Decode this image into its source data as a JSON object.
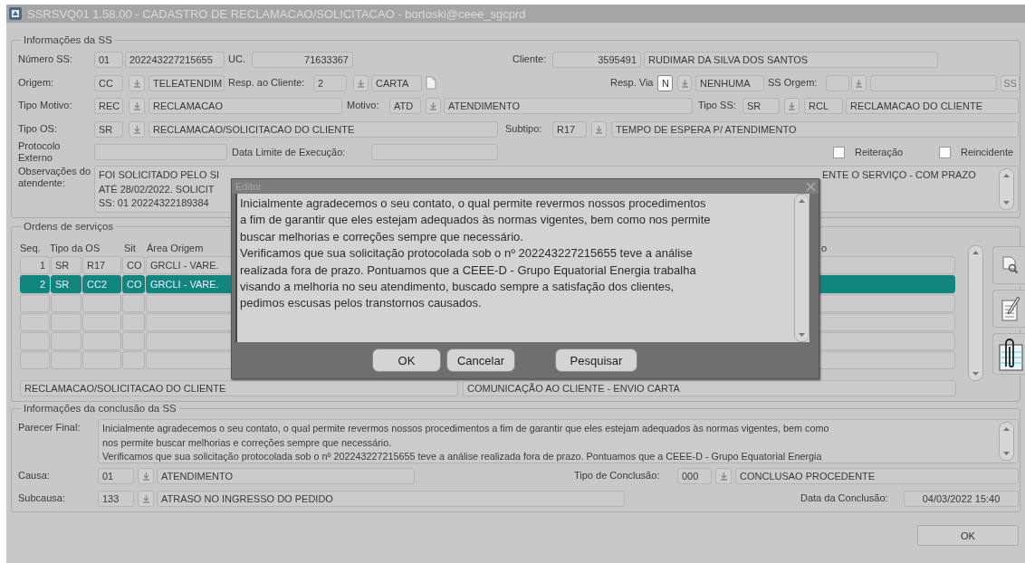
{
  "window": {
    "title": "SSRSVQ01 1.58.00 - CADASTRO DE RECLAMACAO/SOLICITACAO  - bortoski@ceee_sgcprd"
  },
  "info": {
    "title": "Informações da SS",
    "rows": [
      {
        "items": [
          {
            "kind": "label",
            "text": "Número SS:"
          },
          {
            "kind": "field",
            "value": "01"
          },
          {
            "kind": "field",
            "value": "202243227215655"
          },
          {
            "kind": "label",
            "text": "UC."
          },
          {
            "kind": "number",
            "value": "71633367"
          },
          {
            "kind": "label",
            "text": "Cliente:"
          },
          {
            "kind": "number",
            "value": "3595491"
          },
          {
            "kind": "field",
            "value": "RUDIMAR DA SILVA DOS SANTOS"
          }
        ]
      },
      {
        "items": [
          {
            "kind": "label",
            "text": "Origem:"
          },
          {
            "kind": "field",
            "value": "CC"
          },
          {
            "kind": "lov"
          },
          {
            "kind": "field",
            "value": "TELEATENDIM"
          },
          {
            "kind": "label",
            "text": "Resp. ao Cliente:"
          },
          {
            "kind": "field",
            "value": "2"
          },
          {
            "kind": "lov"
          },
          {
            "kind": "field",
            "value": "CARTA"
          },
          {
            "kind": "doc"
          },
          {
            "kind": "label",
            "text": "Resp. Via"
          },
          {
            "kind": "active",
            "value": "N"
          },
          {
            "kind": "lov"
          },
          {
            "kind": "field",
            "value": "NENHUMA"
          },
          {
            "kind": "label",
            "text": "SS Orgem:"
          },
          {
            "kind": "field"
          },
          {
            "kind": "lov"
          },
          {
            "kind": "field"
          },
          {
            "kind": "button",
            "text": "SS"
          }
        ]
      },
      {
        "items": [
          {
            "kind": "label",
            "text": "Tipo Motivo:"
          },
          {
            "kind": "field",
            "value": "REC"
          },
          {
            "kind": "lov"
          },
          {
            "kind": "field",
            "value": "RECLAMACAO"
          },
          {
            "kind": "label",
            "text": "Motivo:"
          },
          {
            "kind": "field",
            "value": "ATD"
          },
          {
            "kind": "lov"
          },
          {
            "kind": "field",
            "value": "ATENDIMENTO"
          },
          {
            "kind": "label",
            "text": "Tipo SS:"
          },
          {
            "kind": "field",
            "value": "SR"
          },
          {
            "kind": "lov"
          },
          {
            "kind": "field",
            "value": "RCL"
          },
          {
            "kind": "field",
            "value": "RECLAMACAO DO CLIENTE"
          }
        ]
      },
      {
        "items": [
          {
            "kind": "label",
            "text": "Tipo OS:"
          },
          {
            "kind": "field",
            "value": "SR"
          },
          {
            "kind": "lov"
          },
          {
            "kind": "field",
            "value": "RECLAMACAO/SOLICITACAO DO CLIENTE"
          },
          {
            "kind": "label",
            "text": "Subtipo:"
          },
          {
            "kind": "field",
            "value": "R17"
          },
          {
            "kind": "lov"
          },
          {
            "kind": "field",
            "value": "TEMPO DE ESPERA P/ ATENDIMENTO"
          }
        ]
      },
      {
        "items": [
          {
            "kind": "label",
            "text": "Protocolo Externo"
          },
          {
            "kind": "field"
          },
          {
            "kind": "label",
            "text": "Data Limite de Execução:"
          },
          {
            "kind": "field"
          },
          {
            "kind": "checkbox",
            "text": "Reiteração",
            "checked": false
          },
          {
            "kind": "checkbox",
            "text": "Reincidente",
            "checked": false
          }
        ]
      }
    ],
    "observations": {
      "label": "Observações do atendente:",
      "left_text": "FOI SOLICITADO PELO SI\nATÉ 28/02/2022. SOLICIT\nSS: 01 20224322189384",
      "right_text": "ENTE O SERVIÇO - COM PRAZO"
    }
  },
  "orders": {
    "title": "Ordens de serviços",
    "columns": [
      "Seq.",
      "Tipo da OS",
      "",
      "Sit",
      "Área Origem",
      "o"
    ],
    "rows": [
      {
        "selected": false,
        "cells": [
          "1",
          "SR",
          "R17",
          "CO",
          "GRCLI - VARE."
        ]
      },
      {
        "selected": true,
        "cells": [
          "2",
          "SR",
          "CC2",
          "CO",
          "GRCLI - VARE."
        ]
      }
    ],
    "footer": [
      "RECLAMACAO/SOLICITACAO DO CLIENTE",
      "COMUNICAÇÃO AO CLIENTE - ENVIO CARTA"
    ]
  },
  "conclusion": {
    "title": "Informações da conclusão da SS",
    "parecer": {
      "label": "Parecer Final:",
      "text": "Inicialmente agradecemos o seu contato, o qual permite revermos nossos procedimentos a fim de garantir que eles estejam adequados às normas vigentes, bem como\nnos permite buscar melhorias e correções sempre que necessário.\nVerificamos que sua solicitação protocolada sob o nº 202243227215655 teve a análise realizada fora de prazo. Pontuamos que a CEEE-D - Grupo Equatorial Energia"
    },
    "rows": [
      {
        "items": [
          {
            "kind": "label",
            "text": "Causa:"
          },
          {
            "kind": "field",
            "value": "01"
          },
          {
            "kind": "lov"
          },
          {
            "kind": "field",
            "value": "ATENDIMENTO"
          },
          {
            "kind": "label",
            "text": "Tipo de Conclusão:"
          },
          {
            "kind": "field",
            "value": "000"
          },
          {
            "kind": "lov"
          },
          {
            "kind": "field",
            "value": "CONCLUSAO PROCEDENTE"
          }
        ]
      },
      {
        "items": [
          {
            "kind": "label",
            "text": "Subcausa:"
          },
          {
            "kind": "field",
            "value": "133"
          },
          {
            "kind": "lov"
          },
          {
            "kind": "field",
            "value": "ATRASO NO INGRESSO DO PEDIDO"
          },
          {
            "kind": "label",
            "text": "Data da Conclusão:"
          },
          {
            "kind": "center",
            "value": "04/03/2022 15:40"
          }
        ]
      }
    ]
  },
  "ok_button": {
    "label": "OK"
  },
  "editor": {
    "title": "Editor",
    "text": "Inicialmente agradecemos o seu contato, o qual permite revermos nossos procedimentos\na fim de garantir que eles estejam adequados às normas vigentes, bem como nos permite\nbuscar melhorias e correções sempre que necessário.\nVerificamos que sua solicitação protocolada sob o nº 202243227215655 teve a análise\nrealizada fora de prazo. Pontuamos que a CEEE-D - Grupo Equatorial Energia trabalha\nvisando a melhoria no seu atendimento, buscado sempre a satisfação dos clientes,\npedimos escusas pelos transtornos causados.",
    "buttons": [
      {
        "label": "OK"
      },
      {
        "label": "Cancelar"
      },
      {
        "label": "Pesquisar"
      }
    ]
  }
}
